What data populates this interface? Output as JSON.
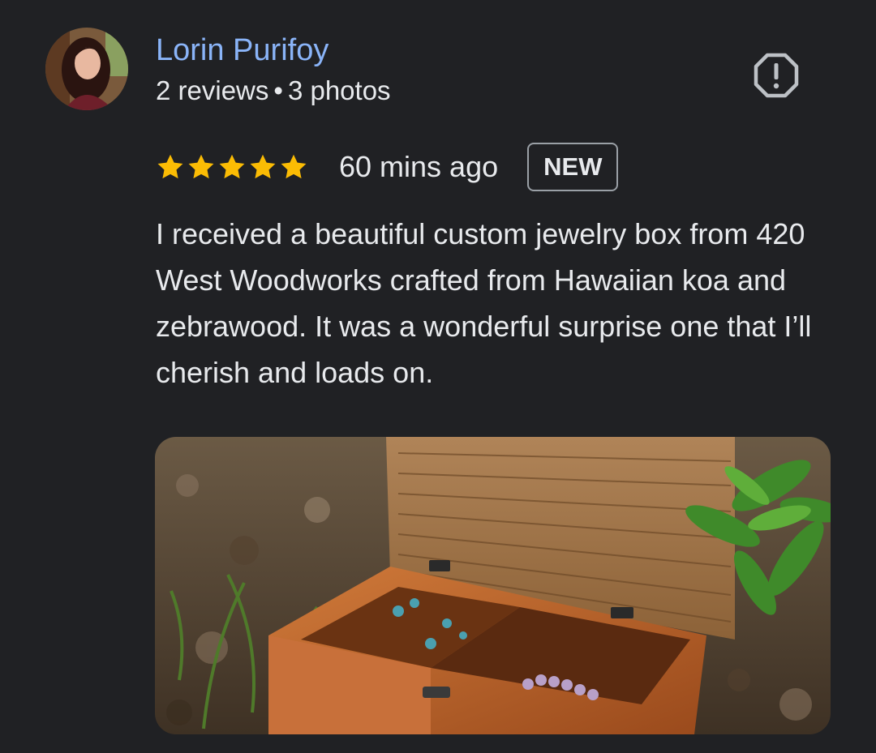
{
  "author": {
    "name": "Lorin Purifoy",
    "reviews": "2 reviews",
    "separator": "•",
    "photos": "3 photos",
    "avatar_icon": "profile-photo"
  },
  "report_icon": "report-flag-icon",
  "rating": {
    "stars": 5,
    "max": 5,
    "star_color": "#fbbc04",
    "time_ago": "60 mins ago",
    "badge": "NEW"
  },
  "review_text": "I received a beautiful custom jewelry box from 420 West Woodworks crafted from Hawaiian koa and zebrawood. It was a wonderful surprise one that I’ll cherish and loads on.",
  "photo": {
    "subject": "open wooden jewelry box on wood-chip ground with green plant"
  },
  "colors": {
    "background": "#202124",
    "link": "#8ab4f8",
    "text": "#e8eaed"
  }
}
